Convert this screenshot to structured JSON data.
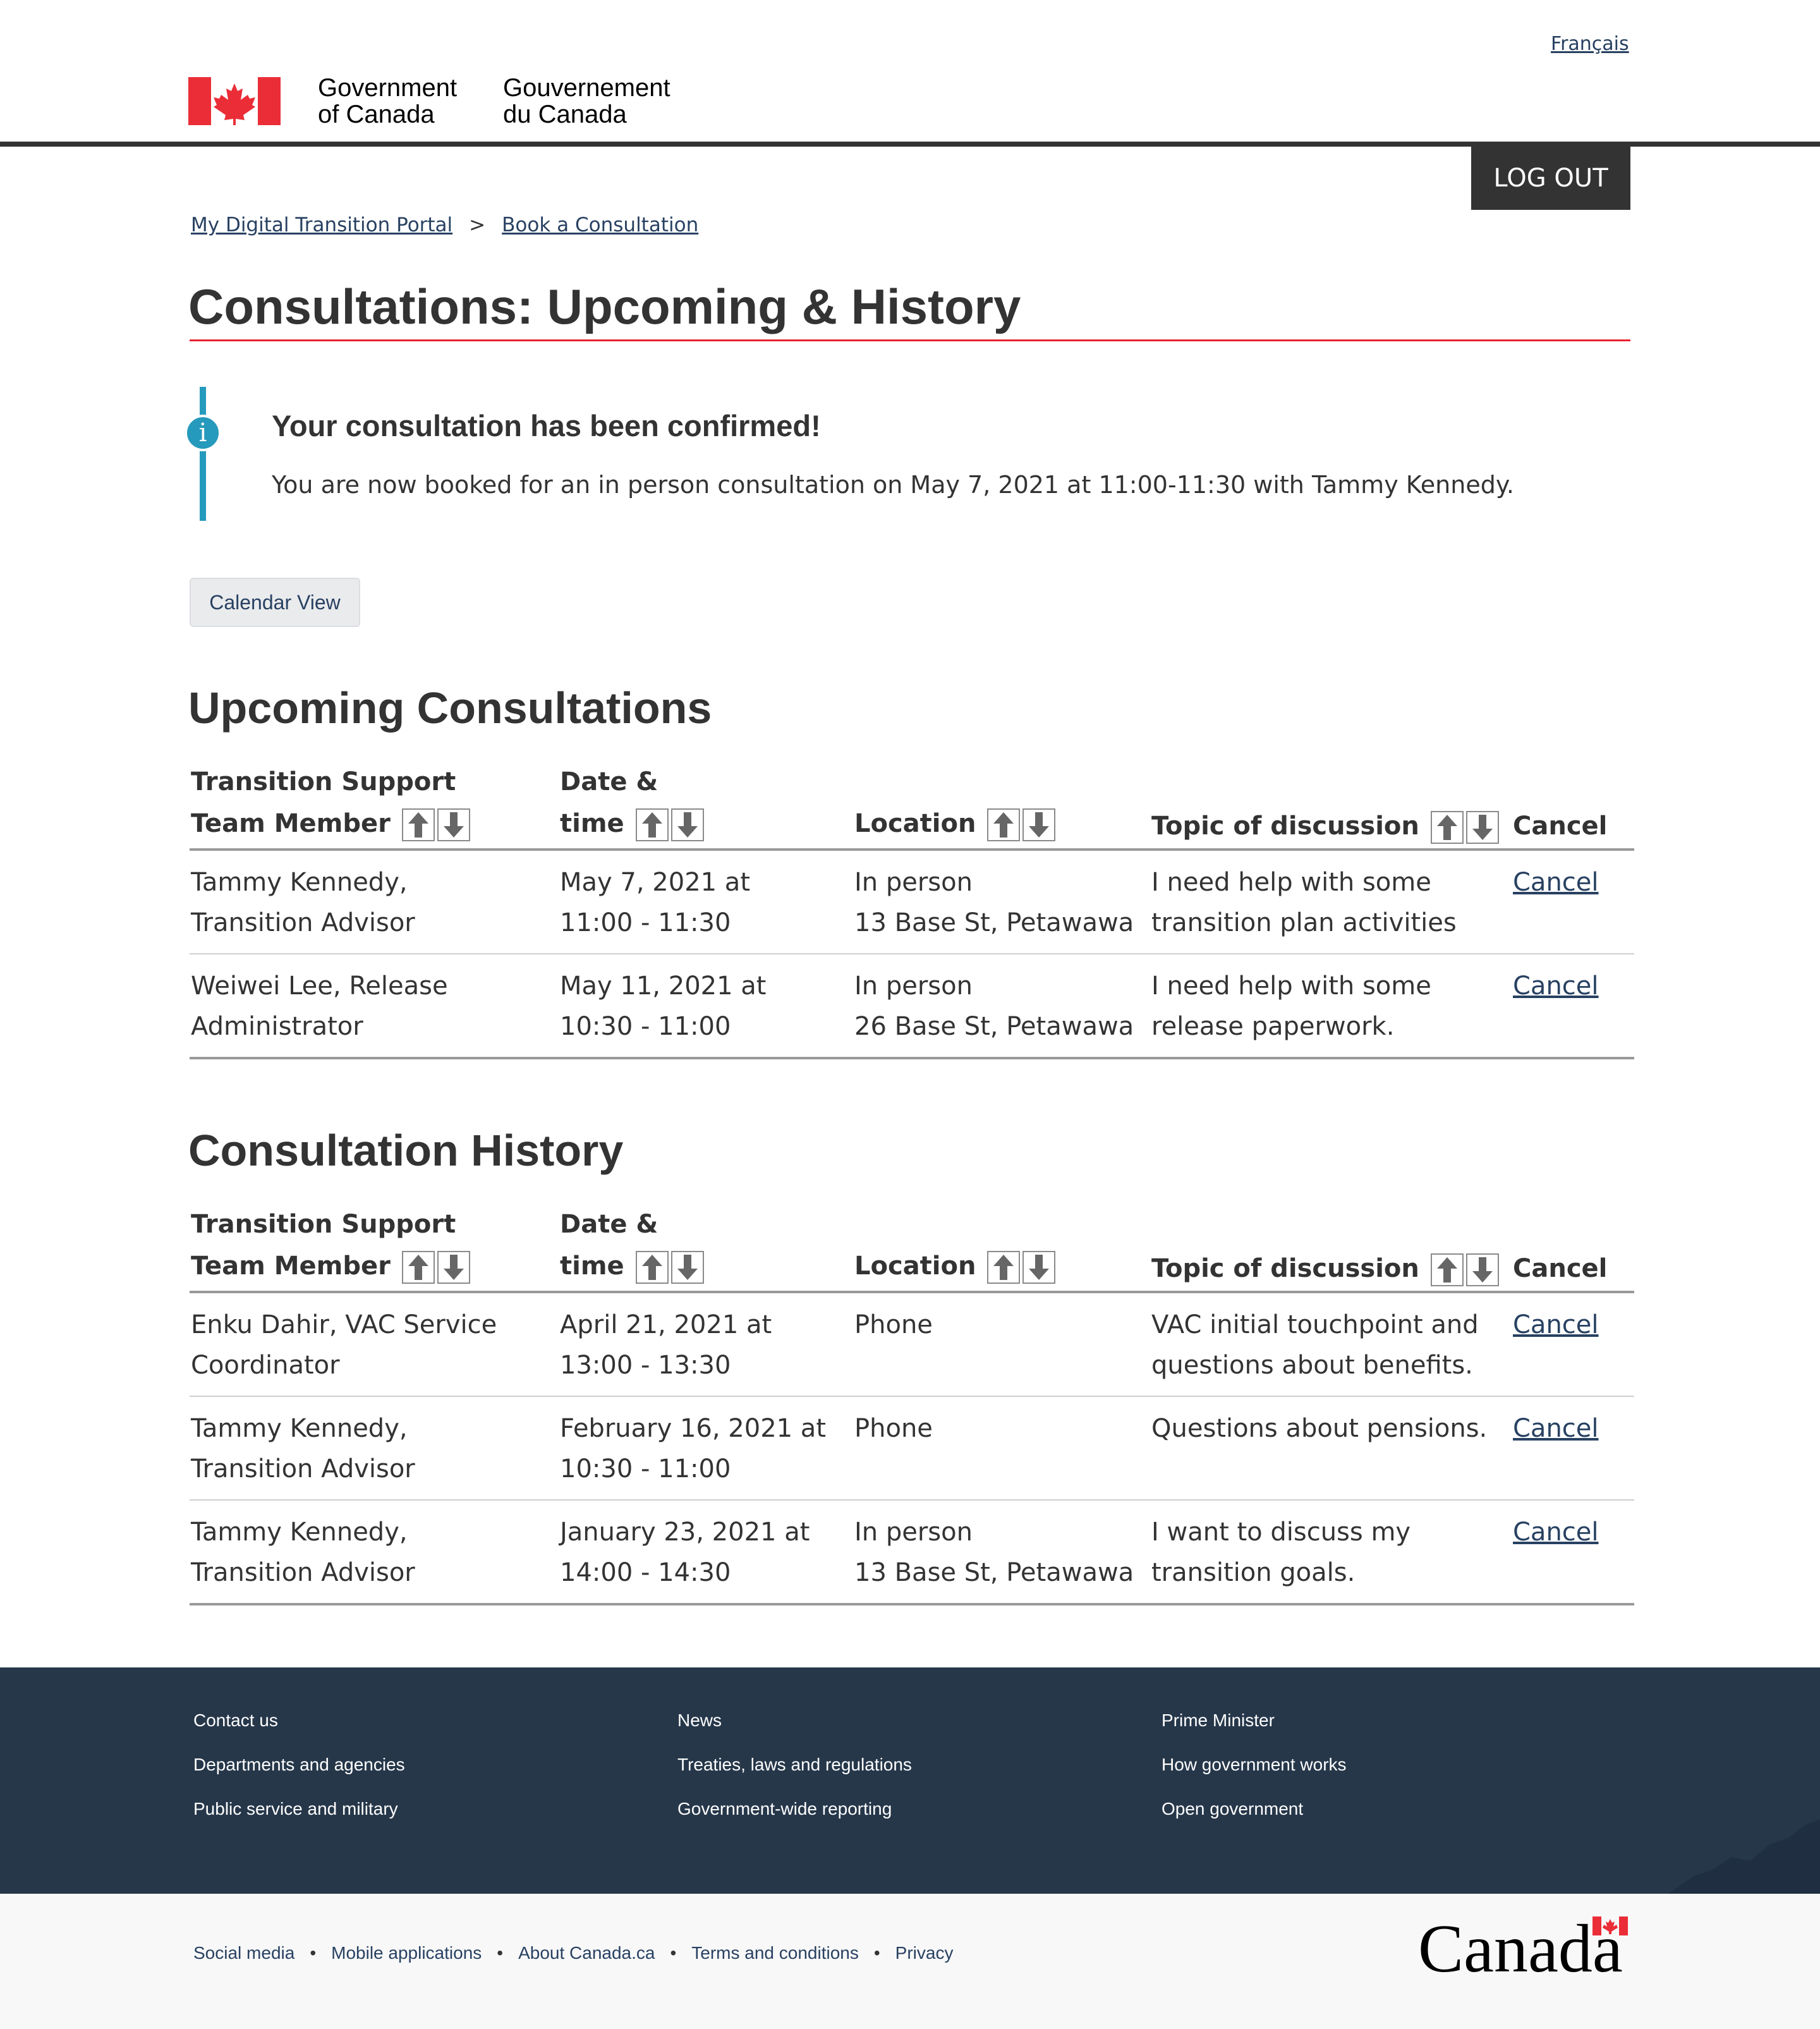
{
  "header": {
    "lang_toggle": "Français",
    "gov_en_line1": "Government",
    "gov_en_line2": "of Canada",
    "gov_fr_line1": "Gouvernement",
    "gov_fr_line2": "du Canada",
    "logout_label": "LOG OUT"
  },
  "breadcrumb": {
    "items": [
      "My Digital Transition Portal",
      "Book a Consultation"
    ],
    "separator": ">"
  },
  "page_title": "Consultations: Upcoming & History",
  "alert": {
    "title": "Your consultation has been confirmed!",
    "body": "You are now booked for an in person consultation on May 7, 2021 at 11:00-11:30 with Tammy Kennedy."
  },
  "calendar_button": "Calendar View",
  "columns": {
    "member_line1": "Transition Support",
    "member_line2": "Team Member",
    "date_line1": "Date &",
    "date_line2": "time",
    "location": "Location",
    "topic": "Topic of discussion",
    "cancel": "Cancel"
  },
  "upcoming": {
    "heading": "Upcoming Consultations",
    "rows": [
      {
        "member": [
          "Tammy Kennedy,",
          "Transition Advisor"
        ],
        "date": [
          "May 7, 2021 at",
          "11:00 - 11:30"
        ],
        "location": [
          "In person",
          "13 Base St, Petawawa"
        ],
        "topic": [
          "I need help with some",
          "transition plan activities"
        ],
        "cancel": "Cancel"
      },
      {
        "member": [
          "Weiwei Lee, Release",
          "Administrator"
        ],
        "date": [
          "May 11, 2021 at",
          "10:30 - 11:00"
        ],
        "location": [
          "In person",
          "26 Base St, Petawawa"
        ],
        "topic": [
          "I need help with some",
          "release paperwork."
        ],
        "cancel": "Cancel"
      }
    ]
  },
  "history": {
    "heading": "Consultation History",
    "rows": [
      {
        "member": [
          "Enku Dahir, VAC Service",
          "Coordinator"
        ],
        "date": [
          "April 21, 2021 at",
          "13:00 - 13:30"
        ],
        "location": [
          "Phone",
          ""
        ],
        "topic": [
          "VAC initial touchpoint and",
          "questions about benefits."
        ],
        "cancel": "Cancel"
      },
      {
        "member": [
          "Tammy Kennedy,",
          "Transition Advisor"
        ],
        "date": [
          "February 16, 2021 at",
          "10:30 - 11:00"
        ],
        "location": [
          "Phone",
          ""
        ],
        "topic": [
          "Questions about pensions.",
          ""
        ],
        "cancel": "Cancel"
      },
      {
        "member": [
          "Tammy Kennedy,",
          "Transition Advisor"
        ],
        "date": [
          "January 23, 2021 at",
          "14:00 - 14:30"
        ],
        "location": [
          "In person",
          "13 Base St, Petawawa"
        ],
        "topic": [
          "I want to discuss my",
          "transition goals."
        ],
        "cancel": "Cancel"
      }
    ]
  },
  "footer": {
    "col1": [
      "Contact us",
      "Departments and agencies",
      "Public service and military"
    ],
    "col2": [
      "News",
      "Treaties, laws and regulations",
      "Government-wide reporting"
    ],
    "col3": [
      "Prime Minister",
      "How government works",
      "Open government"
    ],
    "bottom_links": [
      "Social media",
      "Mobile applications",
      "About Canada.ca",
      "Terms and conditions",
      "Privacy"
    ],
    "separator": "•",
    "wordmark": "Canada"
  },
  "colors": {
    "accent_red": "#e8212f",
    "link_blue": "#284162",
    "info_blue": "#269abc",
    "footer_navy": "#26374a",
    "dark_grey": "#333333"
  },
  "icons": [
    "maple-leaf-flag-icon",
    "info-icon",
    "sort-up-icon",
    "sort-down-icon",
    "canada-wordmark-flag-icon"
  ]
}
